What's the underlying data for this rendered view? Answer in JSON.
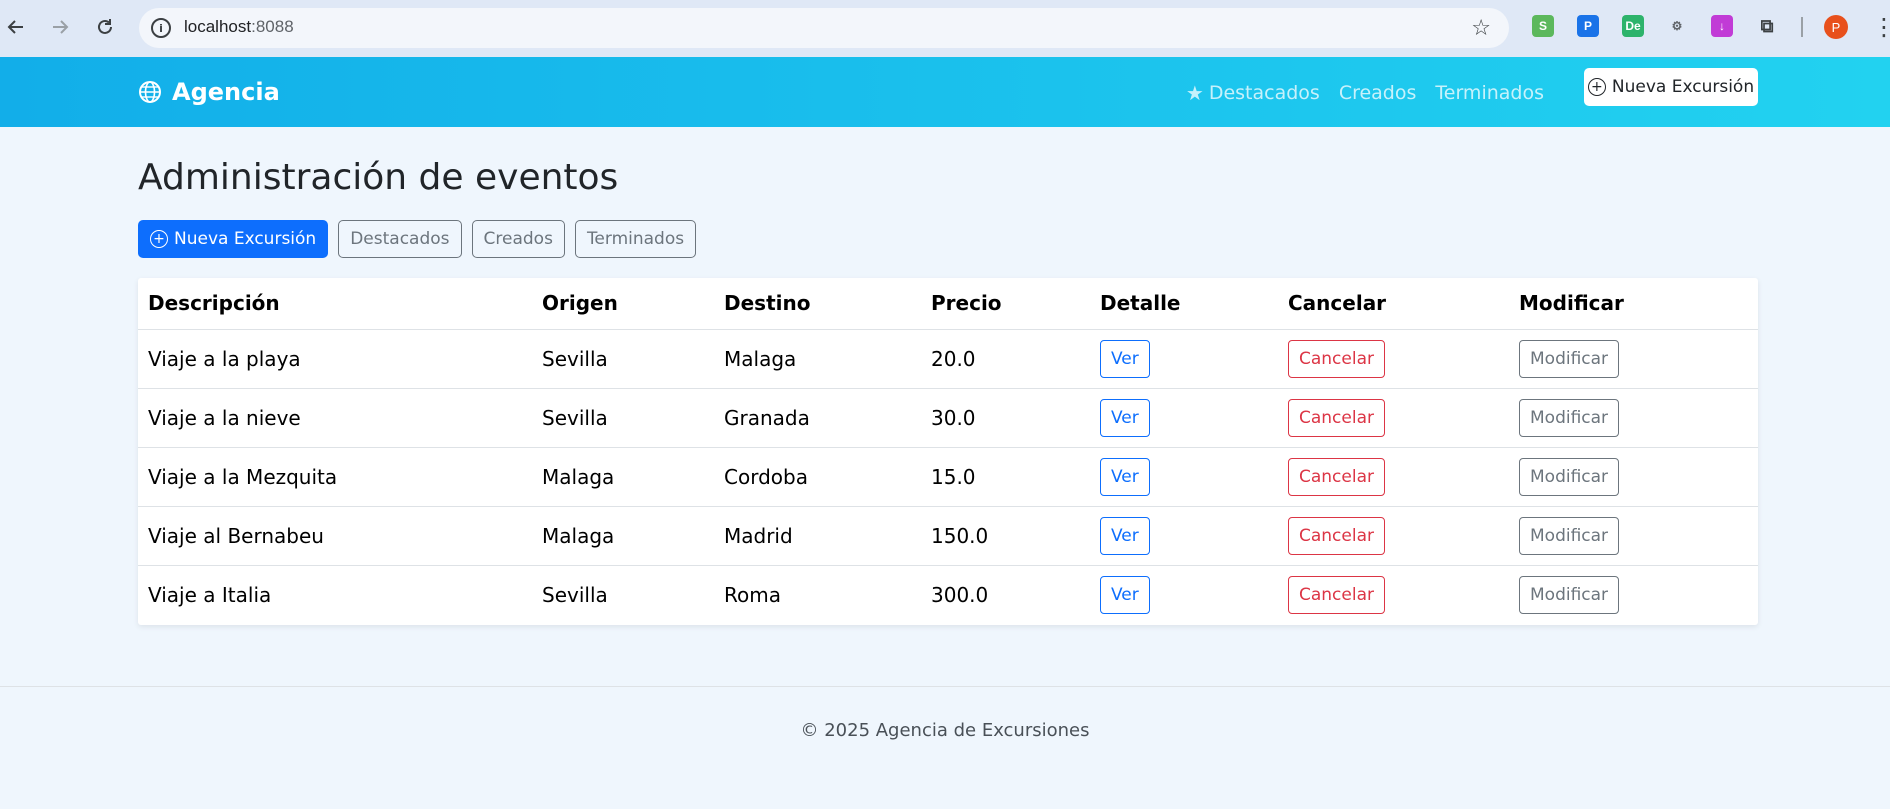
{
  "browser": {
    "url_host": "localhost",
    "url_port": ":8088",
    "avatar_letter": "P",
    "extensions": [
      {
        "name": "ext-s-icon",
        "glyph": "S",
        "color": "#5cb85c"
      },
      {
        "name": "ext-p-icon",
        "glyph": "P",
        "color": "#1a73e8"
      },
      {
        "name": "ext-de-icon",
        "glyph": "De",
        "color": "#2db36b"
      },
      {
        "name": "ext-robot-icon",
        "glyph": "⚙",
        "color": "#5f6368"
      },
      {
        "name": "ext-download-icon",
        "glyph": "↓",
        "color": "#c13bd6"
      },
      {
        "name": "extensions-puzzle-icon",
        "glyph": "⧉",
        "color": "#3c4043"
      }
    ]
  },
  "navbar": {
    "brand": "Agencia",
    "links": [
      {
        "label": "Destacados",
        "icon": "star-icon"
      },
      {
        "label": "Creados"
      },
      {
        "label": "Terminados"
      }
    ],
    "new_button": "Nueva Excursión"
  },
  "main": {
    "title": "Administración de eventos",
    "toolbar": {
      "new_button": "Nueva Excursión",
      "featured": "Destacados",
      "created": "Creados",
      "finished": "Terminados"
    },
    "table": {
      "headers": [
        "Descripción",
        "Origen",
        "Destino",
        "Precio",
        "Detalle",
        "Cancelar",
        "Modificar"
      ],
      "rows": [
        {
          "descripcion": "Viaje a la playa",
          "origen": "Sevilla",
          "destino": "Malaga",
          "precio": "20.0",
          "ver": "Ver",
          "cancelar": "Cancelar",
          "modificar": "Modificar"
        },
        {
          "descripcion": "Viaje a la nieve",
          "origen": "Sevilla",
          "destino": "Granada",
          "precio": "30.0",
          "ver": "Ver",
          "cancelar": "Cancelar",
          "modificar": "Modificar"
        },
        {
          "descripcion": "Viaje a la Mezquita",
          "origen": "Malaga",
          "destino": "Cordoba",
          "precio": "15.0",
          "ver": "Ver",
          "cancelar": "Cancelar",
          "modificar": "Modificar"
        },
        {
          "descripcion": "Viaje al Bernabeu",
          "origen": "Malaga",
          "destino": "Madrid",
          "precio": "150.0",
          "ver": "Ver",
          "cancelar": "Cancelar",
          "modificar": "Modificar"
        },
        {
          "descripcion": "Viaje a Italia",
          "origen": "Sevilla",
          "destino": "Roma",
          "precio": "300.0",
          "ver": "Ver",
          "cancelar": "Cancelar",
          "modificar": "Modificar"
        }
      ]
    }
  },
  "footer": {
    "text": "© 2025 Agencia de Excursiones"
  }
}
